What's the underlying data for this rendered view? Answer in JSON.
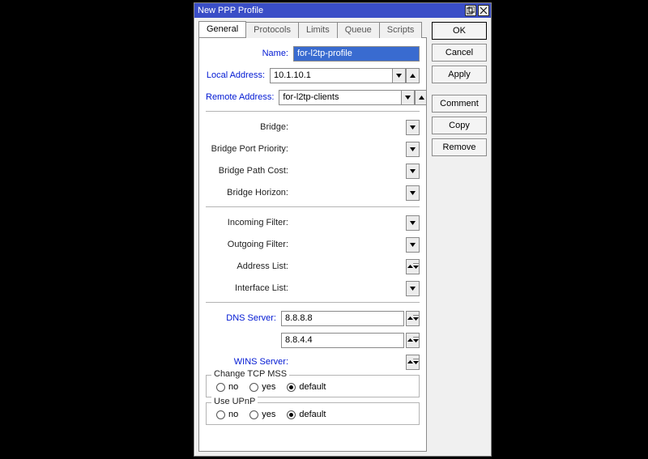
{
  "titlebar": {
    "title": "New PPP Profile"
  },
  "tabs": [
    {
      "label": "General"
    },
    {
      "label": "Protocols"
    },
    {
      "label": "Limits"
    },
    {
      "label": "Queue"
    },
    {
      "label": "Scripts"
    }
  ],
  "buttons": {
    "ok": "OK",
    "cancel": "Cancel",
    "apply": "Apply",
    "comment": "Comment",
    "copy": "Copy",
    "remove": "Remove"
  },
  "form": {
    "name_label": "Name:",
    "name_value": "for-l2tp-profile",
    "local_address_label": "Local Address:",
    "local_address_value": "10.1.10.1",
    "remote_address_label": "Remote Address:",
    "remote_address_value": "for-l2tp-clients",
    "bridge_label": "Bridge:",
    "bridge_value": "",
    "bridge_port_priority_label": "Bridge Port Priority:",
    "bridge_port_priority_value": "",
    "bridge_path_cost_label": "Bridge Path Cost:",
    "bridge_path_cost_value": "",
    "bridge_horizon_label": "Bridge Horizon:",
    "bridge_horizon_value": "",
    "incoming_filter_label": "Incoming Filter:",
    "incoming_filter_value": "",
    "outgoing_filter_label": "Outgoing Filter:",
    "outgoing_filter_value": "",
    "address_list_label": "Address List:",
    "address_list_value": "",
    "interface_list_label": "Interface List:",
    "interface_list_value": "",
    "dns_server_label": "DNS Server:",
    "dns1": "8.8.8.8",
    "dns2": "8.8.4.4",
    "wins_server_label": "WINS Server:",
    "wins_value": "",
    "change_tcp_mss_label": "Change TCP MSS",
    "use_upnp_label": "Use UPnP",
    "radio_no": "no",
    "radio_yes": "yes",
    "radio_default": "default"
  }
}
